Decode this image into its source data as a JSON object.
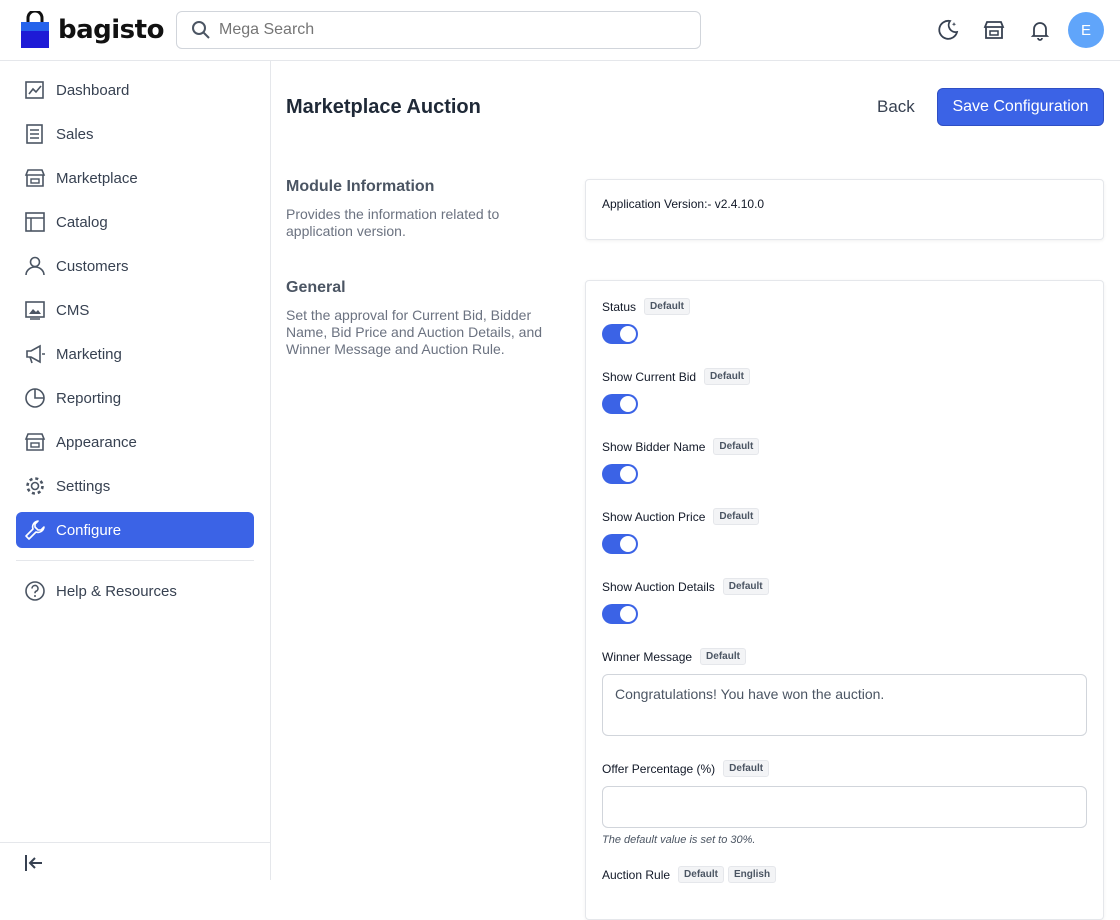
{
  "brand": {
    "name": "bagisto",
    "accent": "#3b63e6"
  },
  "search": {
    "placeholder": "Mega Search"
  },
  "header": {
    "avatar_initial": "E"
  },
  "sidebar": {
    "items": [
      {
        "label": "Dashboard",
        "icon": "dashboard-icon"
      },
      {
        "label": "Sales",
        "icon": "sales-icon"
      },
      {
        "label": "Marketplace",
        "icon": "store-icon"
      },
      {
        "label": "Catalog",
        "icon": "catalog-icon"
      },
      {
        "label": "Customers",
        "icon": "user-icon"
      },
      {
        "label": "CMS",
        "icon": "cms-icon"
      },
      {
        "label": "Marketing",
        "icon": "megaphone-icon"
      },
      {
        "label": "Reporting",
        "icon": "pie-chart-icon"
      },
      {
        "label": "Appearance",
        "icon": "store-icon"
      },
      {
        "label": "Settings",
        "icon": "gear-icon"
      },
      {
        "label": "Configure",
        "icon": "wrench-icon",
        "active": true
      }
    ],
    "help_label": "Help & Resources"
  },
  "page": {
    "title": "Marketplace Auction",
    "back_label": "Back",
    "save_label": "Save Configuration"
  },
  "module_info": {
    "title": "Module Information",
    "description": "Provides the information related to application version.",
    "version_text": "Application Version:- v2.4.10.0"
  },
  "general": {
    "title": "General",
    "description": "Set the approval for Current Bid, Bidder Name, Bid Price and Auction Details, and Winner Message and Auction Rule.",
    "fields": [
      {
        "label": "Status",
        "badge": "Default",
        "type": "toggle",
        "value": true
      },
      {
        "label": "Show Current Bid",
        "badge": "Default",
        "type": "toggle",
        "value": true
      },
      {
        "label": "Show Bidder Name",
        "badge": "Default",
        "type": "toggle",
        "value": true
      },
      {
        "label": "Show Auction Price",
        "badge": "Default",
        "type": "toggle",
        "value": true
      },
      {
        "label": "Show Auction Details",
        "badge": "Default",
        "type": "toggle",
        "value": true
      }
    ],
    "winner_message": {
      "label": "Winner Message",
      "badge": "Default",
      "value": "Congratulations! You have won the auction."
    },
    "offer_percentage": {
      "label": "Offer Percentage (%)",
      "badge": "Default",
      "value": "",
      "hint": "The default value is set to 30%."
    },
    "auction_rule": {
      "label": "Auction Rule",
      "badge": "Default",
      "badge2": "English"
    }
  }
}
